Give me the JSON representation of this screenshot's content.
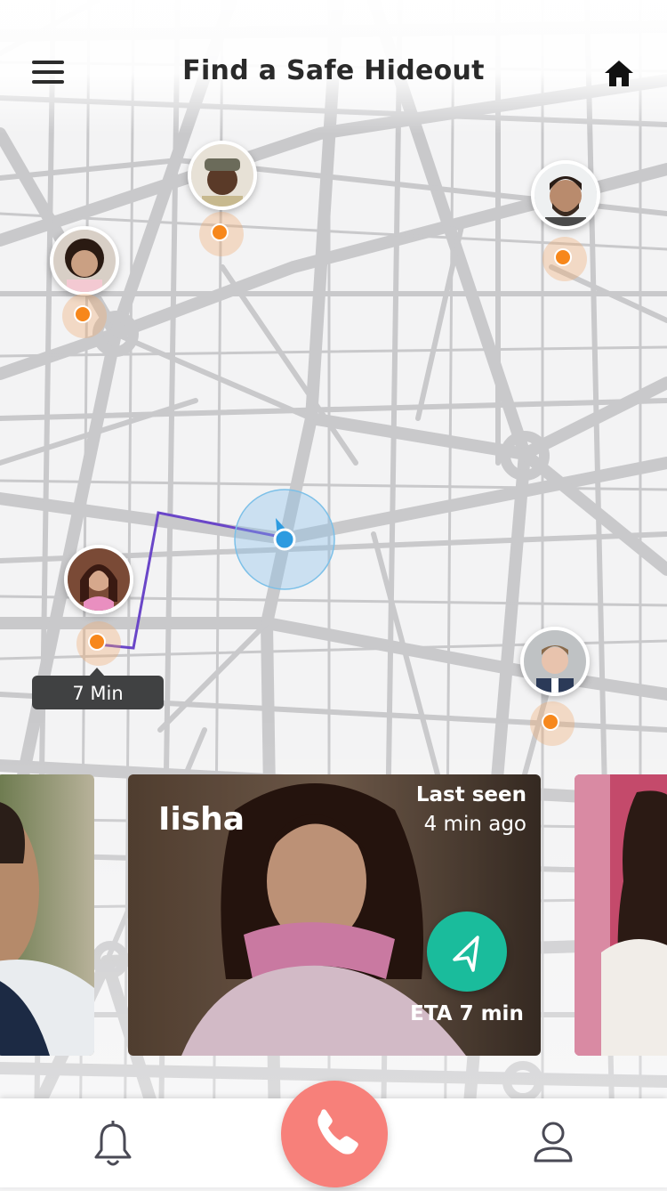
{
  "header": {
    "title": "Find a Safe Hideout",
    "menu_icon": "hamburger-menu-icon",
    "home_icon": "home-icon"
  },
  "map": {
    "route_eta_label": "7 Min",
    "route_color": "#6a46c8",
    "marker_color": "#f7871b"
  },
  "cards": {
    "main": {
      "name": "Iisha",
      "last_seen_label": "Last seen",
      "last_seen_time": "4 min ago",
      "eta_label": "ETA 7 min",
      "navigate_icon": "navigation-arrow-icon",
      "accent": "#1abc9c"
    }
  },
  "bottom_nav": {
    "notifications_icon": "bell-icon",
    "call_icon": "phone-icon",
    "profile_icon": "user-icon",
    "call_color": "#f7807a"
  }
}
